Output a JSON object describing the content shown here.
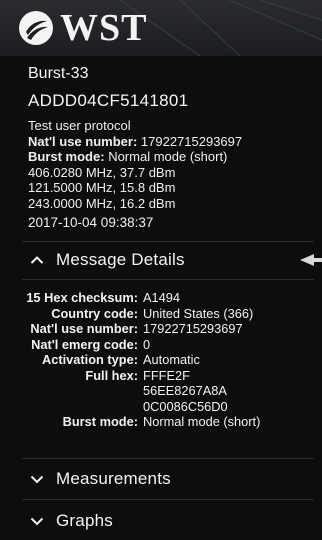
{
  "header": {
    "logo_text": "WST"
  },
  "beacon": {
    "name": "Burst-33",
    "id": "ADDD04CF5141801",
    "protocol": "Test user protocol",
    "nat_use_label": "Nat'l use number:",
    "nat_use_value": "17922715293697",
    "burst_mode_label": "Burst mode:",
    "burst_mode_value": "Normal mode (short)",
    "frequencies": [
      "406.0280 MHz, 37.7 dBm",
      "121.5000 MHz, 15.8 dBm",
      "243.0000 MHz, 16.2 dBm"
    ],
    "timestamp": "2017-10-04 09:38:37"
  },
  "sections": {
    "message_details": "Message Details",
    "measurements": "Measurements",
    "graphs": "Graphs"
  },
  "details": {
    "rows": [
      {
        "label": "15 Hex checksum:",
        "value": "A1494"
      },
      {
        "label": "Country code:",
        "value": "United States (366)"
      },
      {
        "label": "Nat'l use number:",
        "value": "17922715293697"
      },
      {
        "label": "Nat'l emerg code:",
        "value": "0"
      },
      {
        "label": "Activation type:",
        "value": "Automatic"
      }
    ],
    "full_hex_label": "Full hex:",
    "full_hex_lines": [
      "FFFE2F",
      "56EE8267A8A",
      "0C0086C56D0"
    ],
    "burst_mode_label": "Burst mode:",
    "burst_mode_value": "Normal mode (short)"
  },
  "colors": {
    "background": "#0d0d0d",
    "text": "#f2f2f2",
    "divider": "#2c2c2c"
  },
  "icons": {
    "expanded": "chevron-up-icon",
    "collapsed": "chevron-down-icon"
  }
}
